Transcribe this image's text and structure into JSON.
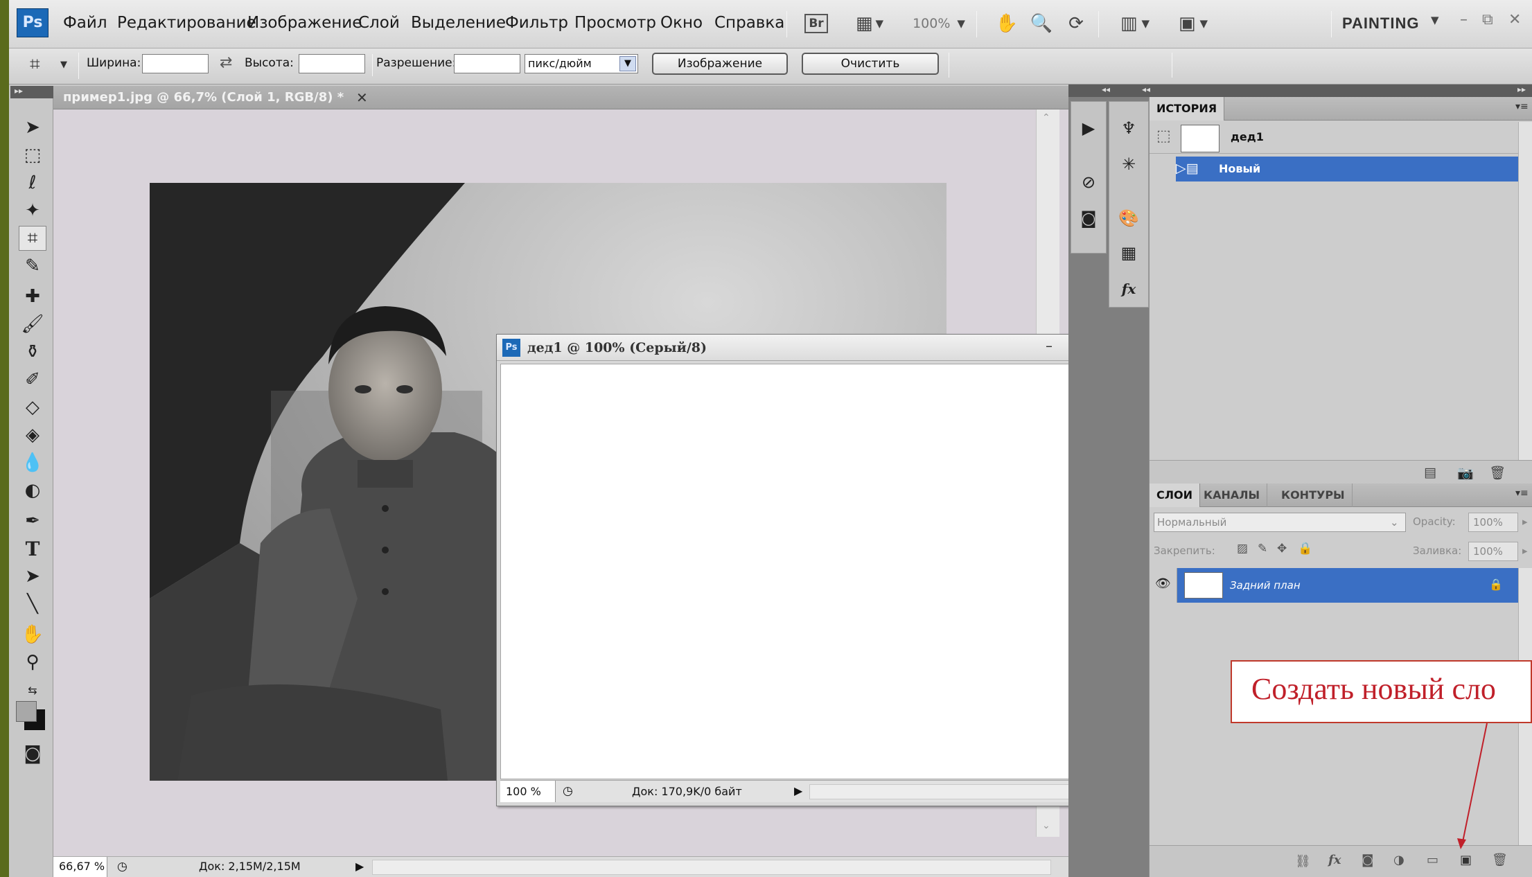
{
  "menubar": {
    "logo": "Ps",
    "items": [
      "Файл",
      "Редактирование",
      "Изображение",
      "Слой",
      "Выделение",
      "Фильтр",
      "Просмотр",
      "Окно",
      "Справка"
    ],
    "bridge": "Br",
    "zoom": "100%",
    "workspace": "PAINTING"
  },
  "options": {
    "width_label": "Ширина:",
    "height_label": "Высота:",
    "resolution_label": "Разрешение:",
    "unit": "пикс/дюйм",
    "image_button": "Изображение",
    "clear_button": "Очистить"
  },
  "document": {
    "tab_title": "пример1.jpg @ 66,7% (Слой 1, RGB/8) *",
    "zoom": "66,67 %",
    "doc_size": "Док: 2,15M/2,15M"
  },
  "floating_window": {
    "logo": "Ps",
    "title": "дед1 @ 100% (Серый/8)",
    "zoom": "100 %",
    "doc_size": "Док: 170,9K/0 байт"
  },
  "history": {
    "tab": "ИСТОРИЯ",
    "snapshot": "дед1",
    "state": "Новый"
  },
  "layers": {
    "tabs": [
      "СЛОИ",
      "КАНАЛЫ",
      "КОНТУРЫ"
    ],
    "blend_mode": "Нормальный",
    "opacity_label": "Opacity:",
    "opacity_value": "100%",
    "lock_label": "Закрепить:",
    "fill_label": "Заливка:",
    "fill_value": "100%",
    "layer_name": "Задний план"
  },
  "callout": {
    "text": "Создать новый сло"
  }
}
